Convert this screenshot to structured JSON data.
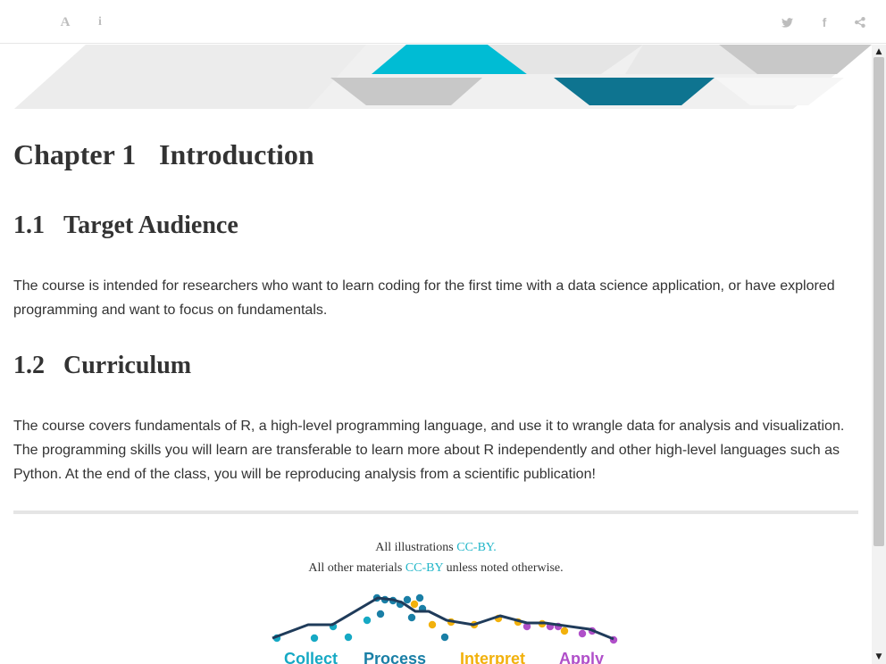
{
  "toolbar": {
    "left_icons": [
      "font-settings-icon",
      "info-icon"
    ],
    "right_icons": [
      "twitter-icon",
      "facebook-icon",
      "share-icon"
    ],
    "font_glyph": "A",
    "info_glyph": "i",
    "facebook_glyph": "f"
  },
  "banner": {
    "colors": {
      "teal": "#00bcd4",
      "dark_teal": "#0e7490",
      "light_gray": "#e6e6e6",
      "mid_gray": "#c8c8c8"
    }
  },
  "chapter": {
    "number": "Chapter 1",
    "title": "Introduction"
  },
  "sections": [
    {
      "number": "1.1",
      "title": "Target Audience",
      "text": "The course is intended for researchers who want to learn coding for the first time with a data science application, or have explored programming and want to focus on fundamentals."
    },
    {
      "number": "1.2",
      "title": "Curriculum",
      "text": "The course covers fundamentals of R, a high-level programming language, and use it to wrangle data for analysis and visualization. The programming skills you will learn are transferable to learn more about R independently and other high-level languages such as Python. At the end of the class, you will be reproducing analysis from a scientific publication!"
    }
  ],
  "footer": {
    "line1_prefix": "All illustrations ",
    "line1_link": "CC-BY.",
    "line2_prefix": "All other materials ",
    "line2_link": "CC-BY",
    "line2_suffix": " unless noted otherwise.",
    "stages": [
      {
        "label": "Collect",
        "color": "#16a9c4"
      },
      {
        "label": "Process",
        "color": "#1a7fa6"
      },
      {
        "label": "Interpret",
        "color": "#f2b10c"
      },
      {
        "label": "Apply",
        "color": "#b04fc9"
      }
    ],
    "line_color": "#1f3b5a"
  }
}
